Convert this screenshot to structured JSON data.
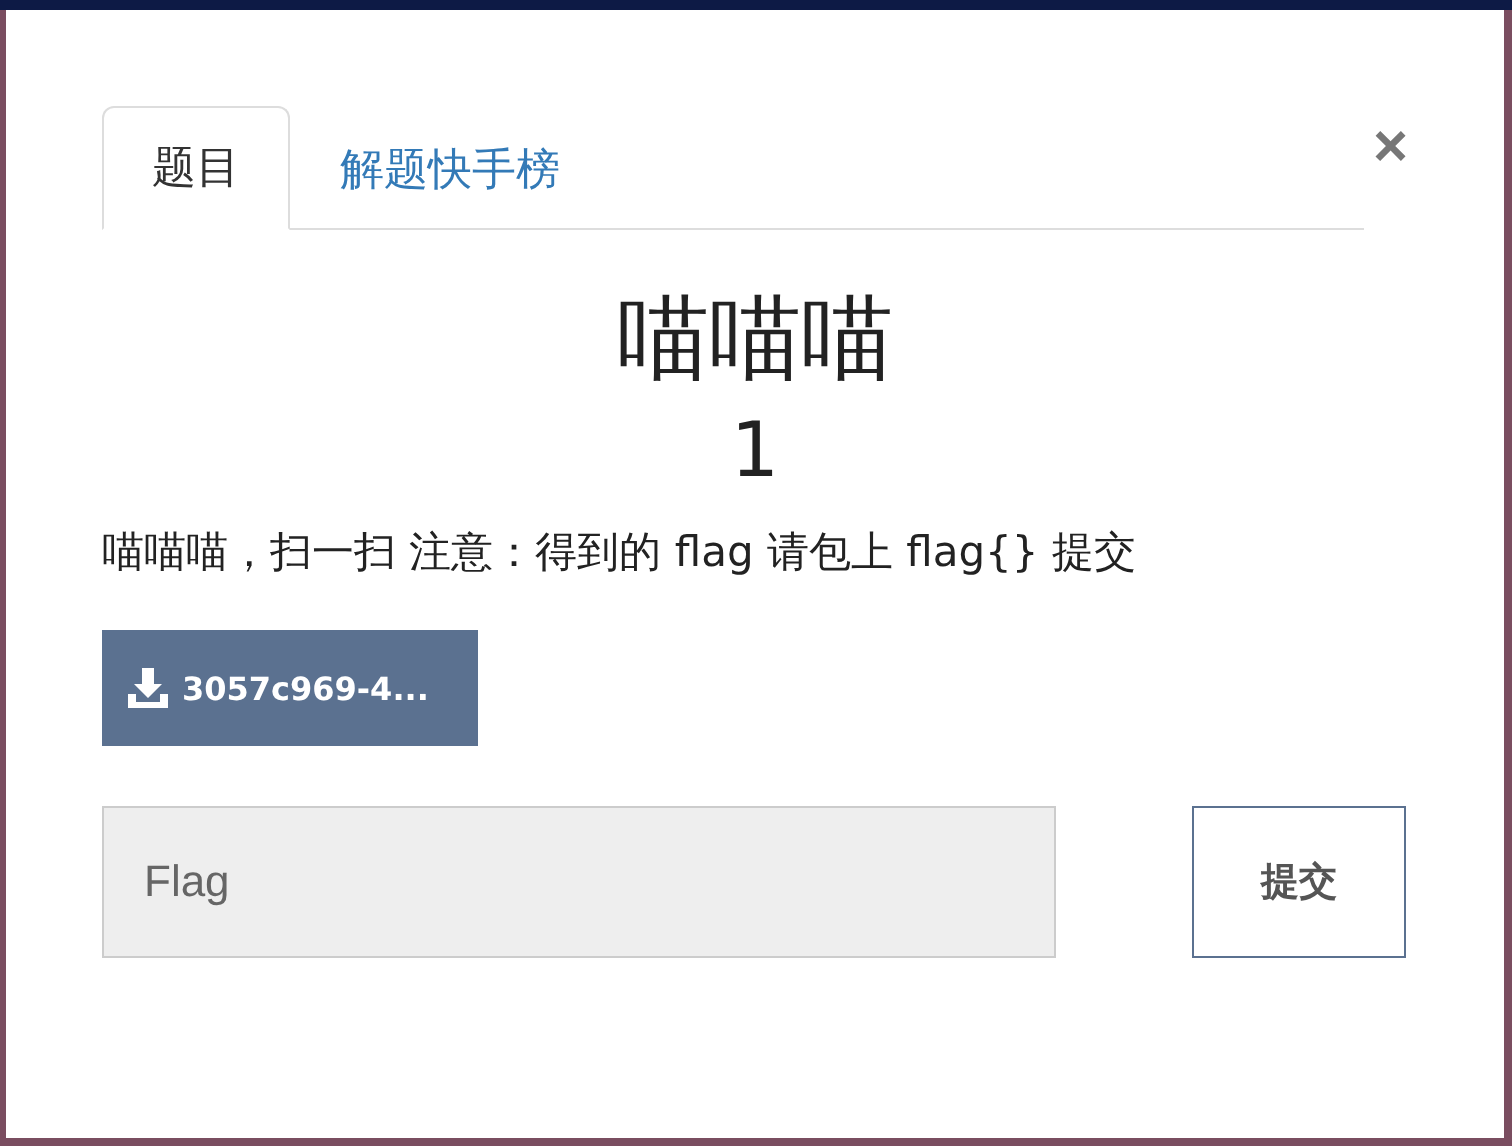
{
  "tabs": [
    {
      "label": "题目",
      "selected": true
    },
    {
      "label": "解题快手榜",
      "selected": false
    }
  ],
  "close": "×",
  "challenge": {
    "title": "喵喵喵",
    "score": "1",
    "description": "喵喵喵，扫一扫 注意：得到的 flag 请包上 flag{} 提交"
  },
  "download": {
    "label": "3057c969-4..."
  },
  "flag_input": {
    "placeholder": "Flag"
  },
  "submit": "提交"
}
